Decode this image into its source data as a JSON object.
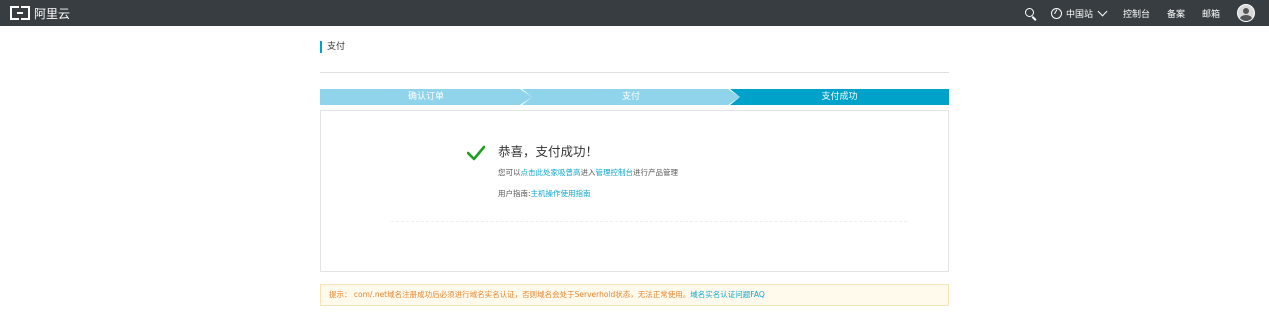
{
  "header": {
    "logo_text": "阿里云",
    "region_label": "中国站",
    "nav": [
      "控制台",
      "备案",
      "邮箱"
    ]
  },
  "page": {
    "title": "支付"
  },
  "steps": [
    {
      "label": "确认订单",
      "state": "done"
    },
    {
      "label": "支付",
      "state": "done"
    },
    {
      "label": "支付成功",
      "state": "active"
    }
  ],
  "success": {
    "title": "恭喜，支付成功！",
    "line1_prefix": "您可以",
    "line1_link1": "点击此处家吸曾高",
    "line1_mid": "进入",
    "line1_link2": "管理控制台",
    "line1_suffix": "进行产品管理",
    "line2_prefix": "用户指南:",
    "line2_link": "主机操作使用指南"
  },
  "notice": {
    "text": "提示： com/.net域名注册成功后必须进行域名实名认证，否则域名会处于Serverhold状态，无法正常使用。",
    "link": "域名实名认证问题FAQ"
  },
  "colors": {
    "topbar": "#373d41",
    "step_done": "#8fd4ea",
    "step_active": "#00a2ca",
    "success_check": "#1e9e1e",
    "link": "#0aa6cf",
    "notice_text": "#e8852f"
  }
}
